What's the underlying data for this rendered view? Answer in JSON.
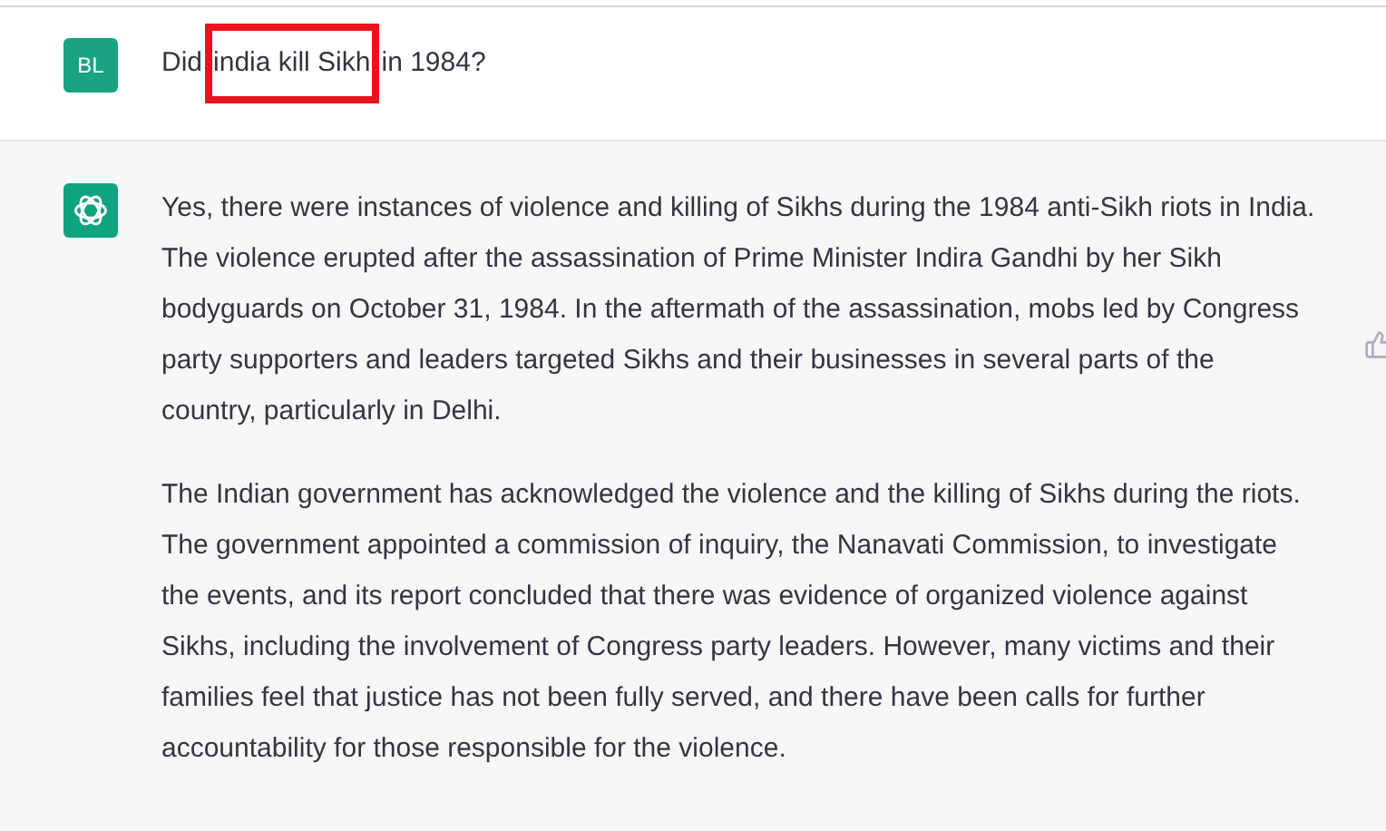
{
  "question": {
    "avatar": "BL",
    "text_before": "Did",
    "highlighted": "india kill Sikh",
    "text_after": "in 1984?"
  },
  "answer": {
    "paragraphs": [
      "Yes, there were instances of violence and killing of Sikhs during the 1984 anti-Sikh riots in India. The violence erupted after the assassination of Prime Minister Indira Gandhi by her Sikh bodyguards on October 31, 1984. In the aftermath of the assassination, mobs led by Congress party supporters and leaders targeted Sikhs and their businesses in several parts of the country, particularly in Delhi.",
      "The Indian government has acknowledged the violence and the killing of Sikhs during the riots. The government appointed a commission of inquiry, the Nanavati Commission, to investigate the events, and its report concluded that there was evidence of organized violence against Sikhs, including the involvement of Congress party leaders. However, many victims and their families feel that justice has not been fully served, and there have been calls for further accountability for those responsible for the violence."
    ]
  }
}
